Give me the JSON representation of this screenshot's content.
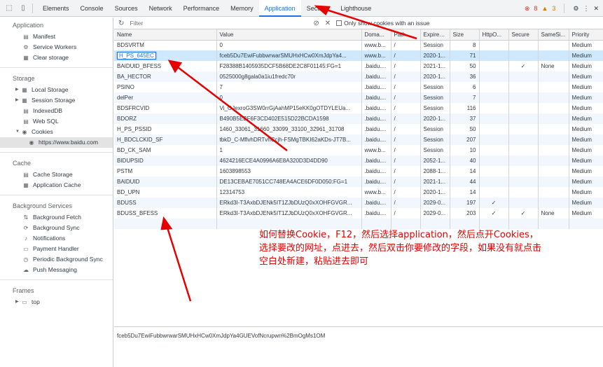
{
  "toolbar": {
    "tabs": [
      "Elements",
      "Console",
      "Sources",
      "Network",
      "Performance",
      "Memory",
      "Application",
      "Security",
      "Lighthouse"
    ],
    "active_tab": "Application",
    "errors": "8",
    "warnings": "3"
  },
  "sidebar": {
    "application_title": "Application",
    "application_items": [
      "Manifest",
      "Service Workers",
      "Clear storage"
    ],
    "storage_title": "Storage",
    "storage_items": [
      "Local Storage",
      "Session Storage",
      "IndexedDB",
      "Web SQL",
      "Cookies"
    ],
    "cookies_child": "https://www.baidu.com",
    "cache_title": "Cache",
    "cache_items": [
      "Cache Storage",
      "Application Cache"
    ],
    "bg_title": "Background Services",
    "bg_items": [
      "Background Fetch",
      "Background Sync",
      "Notifications",
      "Payment Handler",
      "Periodic Background Sync",
      "Push Messaging"
    ],
    "frames_title": "Frames",
    "frames_items": [
      "top"
    ]
  },
  "filter": {
    "placeholder": "Filter",
    "only_issue_label": "Only show cookies with an issue"
  },
  "table": {
    "columns": [
      "Name",
      "Value",
      "Doma...",
      "Path",
      "Expires...",
      "Size",
      "HttpO...",
      "Secure",
      "SameSi...",
      "Priority"
    ],
    "rows": [
      [
        "BDSVRTM",
        "0",
        "www.b...",
        "/",
        "Session",
        "8",
        "",
        "",
        "",
        "Medium"
      ],
      [
        "H_PS_645EC",
        "fceb5Du7EwiFubbwrwarSMUHxHCw0XmJdpYa4...",
        "www.b...",
        "/",
        "2020-1...",
        "71",
        "",
        "",
        "",
        "Medium"
      ],
      [
        "BAIDUID_BFESS",
        "F28388B1405935DCF5B68DE2C8F01145:FG=1",
        ".baidu....",
        "/",
        "2021-1...",
        "50",
        "",
        "✓",
        "None",
        "Medium"
      ],
      [
        "BA_HECTOR",
        "0525000g8gala0a1iu1fredc70r",
        ".baidu....",
        "/",
        "2020-1...",
        "36",
        "",
        "",
        "",
        "Medium"
      ],
      [
        "PSINO",
        "7",
        ".baidu....",
        "/",
        "Session",
        "6",
        "",
        "",
        "",
        "Medium"
      ],
      [
        "delPer",
        "0",
        ".baidu....",
        "/",
        "Session",
        "7",
        "",
        "",
        "",
        "Medium"
      ],
      [
        "BDSFRCVID",
        "Vi_OJexroG3SW0rrGjAahMP15eKK0gOTDYLEUa...",
        ".baidu....",
        "/",
        "Session",
        "116",
        "",
        "",
        "",
        "Medium"
      ],
      [
        "BDORZ",
        "B490B5EBF6F3CD402E515D22BCDA1598",
        ".baidu....",
        "/",
        "2020-1...",
        "37",
        "",
        "",
        "",
        "Medium"
      ],
      [
        "H_PS_PSSID",
        "1460_33061_31660_33099_33100_32961_31708",
        ".baidu....",
        "/",
        "Session",
        "50",
        "",
        "",
        "",
        "Medium"
      ],
      [
        "H_BDCLCKID_SF",
        "tbkD_C-MflvhDRTvhCcjh-FSMgTBKI62aKDs-JT7B...",
        ".baidu....",
        "/",
        "Session",
        "207",
        "",
        "",
        "",
        "Medium"
      ],
      [
        "BD_CK_SAM",
        "1",
        "www.b...",
        "/",
        "Session",
        "10",
        "",
        "",
        "",
        "Medium"
      ],
      [
        "BIDUPSID",
        "4624216ECE4A0996A6E8A320D3D4DD90",
        ".baidu....",
        "/",
        "2052-1...",
        "40",
        "",
        "",
        "",
        "Medium"
      ],
      [
        "PSTM",
        "1603898553",
        ".baidu....",
        "/",
        "2088-1...",
        "14",
        "",
        "",
        "",
        "Medium"
      ],
      [
        "BAIDUID",
        "DE13CEBAE7051CC748EA4ACE6DF0D050:FG=1",
        ".baidu....",
        "/",
        "2021-1...",
        "44",
        "",
        "",
        "",
        "Medium"
      ],
      [
        "BD_UPN",
        "12314753",
        "www.b...",
        "/",
        "2020-1...",
        "14",
        "",
        "",
        "",
        "Medium"
      ],
      [
        "BDUSS",
        "ERkd3I-T3AxbDJENk5IT1ZJbDUzQ0xXOHFGVGR...",
        ".baidu....",
        "/",
        "2029-0...",
        "197",
        "✓",
        "",
        "",
        "Medium"
      ],
      [
        "BDUSS_BFESS",
        "ERkd3I-T3AxbDJENk5IT1ZJbDUzQ0xXOHFGVGR...",
        ".baidu....",
        "/",
        "2029-0...",
        "203",
        "✓",
        "✓",
        "None",
        "Medium"
      ]
    ]
  },
  "bottom_value": "fceb5Du7EwiFubbwrwarSMUHxHCw0XmJdpYa4GUEVofNcrupwn%2BmOgMs1OM",
  "annotation": {
    "line1": "如何替换Cookie，F12，然后选择application，然后点开Cookies，",
    "line2": "选择要改的网址，点进去，然后双击你要修改的字段，如果没有就点击",
    "line3": "空白处新建，粘贴进去即可"
  },
  "colors": {
    "accent": "#1a73e8",
    "annotation": "#e60000"
  }
}
